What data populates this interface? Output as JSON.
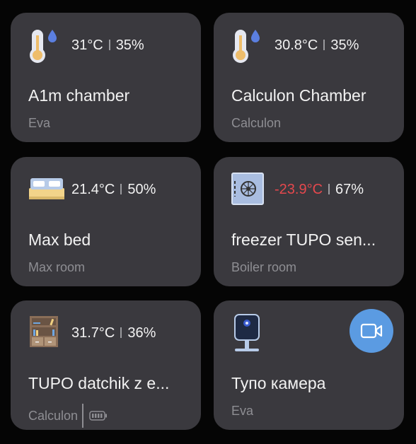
{
  "colors": {
    "card": "#3a393e",
    "accent": "#5b9be2",
    "negative_temp": "#e5484d"
  },
  "cards": [
    {
      "icon": "thermometer-humidity-icon",
      "temp": "31°C",
      "humidity": "35%",
      "name": "A1m chamber",
      "room": "Eva"
    },
    {
      "icon": "thermometer-humidity-icon",
      "temp": "30.8°C",
      "humidity": "35%",
      "name": "Calculon Chamber",
      "room": "Calculon"
    },
    {
      "icon": "bed-icon",
      "temp": "21.4°C",
      "humidity": "50%",
      "name": "Max bed",
      "room": "Max room"
    },
    {
      "icon": "safe-icon",
      "temp": "-23.9°C",
      "humidity": "67%",
      "name": "freezer TUPO sen...",
      "room": "Boiler room"
    },
    {
      "icon": "bookshelf-icon",
      "temp": "31.7°C",
      "humidity": "36%",
      "name": "TUPO datchik z e...",
      "room": "Calculon",
      "battery": "battery-full-icon"
    },
    {
      "icon": "camera-icon",
      "name": "Тупо камера",
      "room": "Eva",
      "action": "video-camera-icon"
    }
  ]
}
